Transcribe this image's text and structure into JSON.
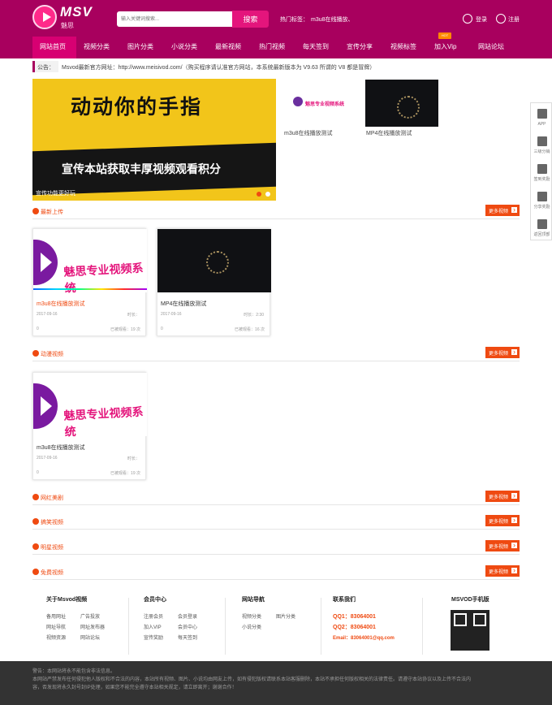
{
  "header": {
    "logo": "MSV",
    "logo_sub": "魅思",
    "search_placeholder": "输入关键词搜索...",
    "search_button": "搜索",
    "hot_label": "热门标签：",
    "hot_keyword": "m3u8在线播放、",
    "login": "登录",
    "register": "注册"
  },
  "nav": {
    "items": [
      "网站首页",
      "视频分类",
      "图片分类",
      "小说分类",
      "最新视频",
      "热门视频",
      "每天签到",
      "宣传分享",
      "视频标签",
      "加入Vip",
      "网站论坛"
    ],
    "hot_badge": "HOT"
  },
  "notice": {
    "label": "公告：",
    "text": "Msvod最新官方网址：http://www.meisivod.com/（购买程序请认准官方网站，本系统最新版本为 V9.63 所谓的 V8 都是冒牌）"
  },
  "banner": {
    "title": "动动你的手指",
    "subtitle": "宣传本站获取丰厚视频观看积分",
    "caption": "宣传功能更好玩"
  },
  "featured": [
    {
      "title": "m3u8在线播放测试",
      "logo": "魅思专业视频系统"
    },
    {
      "title": "MP4在线播放测试"
    }
  ],
  "sections": {
    "latest": {
      "title": "最新上传",
      "more": "更多视频"
    },
    "anime": {
      "title": "动漫视频",
      "more": "更多视频"
    },
    "web": {
      "title": "网红美剧",
      "more": "更多视频"
    },
    "funny": {
      "title": "搞笑视频",
      "more": "更多视频"
    },
    "star": {
      "title": "明星视频",
      "more": "更多视频"
    },
    "free": {
      "title": "免费视频",
      "more": "更多视频"
    }
  },
  "cards": [
    {
      "title": "m3u8在线播放测试",
      "logo": "魅思专业视频系统",
      "date": "2017-09-16",
      "duration": "时长：",
      "likes": "0",
      "views": "已被观看：19 次"
    },
    {
      "title": "MP4在线播放测试",
      "date": "2017-09-16",
      "duration": "时长：2:30",
      "likes": "0",
      "views": "已被观看：16 次"
    },
    {
      "title": "m3u8在线播放测试",
      "logo": "魅思专业视频系统",
      "date": "2017-09-16",
      "duration": "时长：",
      "likes": "0",
      "views": "已被观看：19 次"
    }
  ],
  "side": [
    {
      "label": "APP"
    },
    {
      "label": "三级分销"
    },
    {
      "label": "签到奖励"
    },
    {
      "label": "分享奖励"
    },
    {
      "label": "返回顶部"
    }
  ],
  "footer": {
    "about": {
      "title": "关于Msvod视频",
      "items": [
        "备用网址",
        "广告投放",
        "网址导航",
        "网址发布器",
        "视频资源",
        "网站论坛"
      ]
    },
    "member": {
      "title": "会员中心",
      "items": [
        "注册会员",
        "会员登录",
        "加入VIP",
        "会员中心",
        "宣传奖励",
        "每天签到"
      ]
    },
    "nav": {
      "title": "网站导航",
      "items": [
        "视频分类",
        "图片分类",
        "小说分类"
      ]
    },
    "contact": {
      "title": "联系我们",
      "items": [
        "QQ1：83064001",
        "QQ2：83064001",
        "Email：83064001@qq.com"
      ]
    },
    "mobile": {
      "title": "MSVOD手机版"
    },
    "disclaimer": [
      "警告：本网站将永不能包含非法信息。",
      "本网站严禁发布任何侵犯他人版权和不合法的内容，本站所有视频、图片、小说均由网友上传，如有侵犯版权请联系本站客服删除，本站不承担任何版权相关的法律责任。请遵守本站协议以及上传不合法内",
      "容，否发现将永久封号封IP处理，如果您不能完全遵守本站相关规定，请立即离开；谢谢合作！"
    ]
  }
}
